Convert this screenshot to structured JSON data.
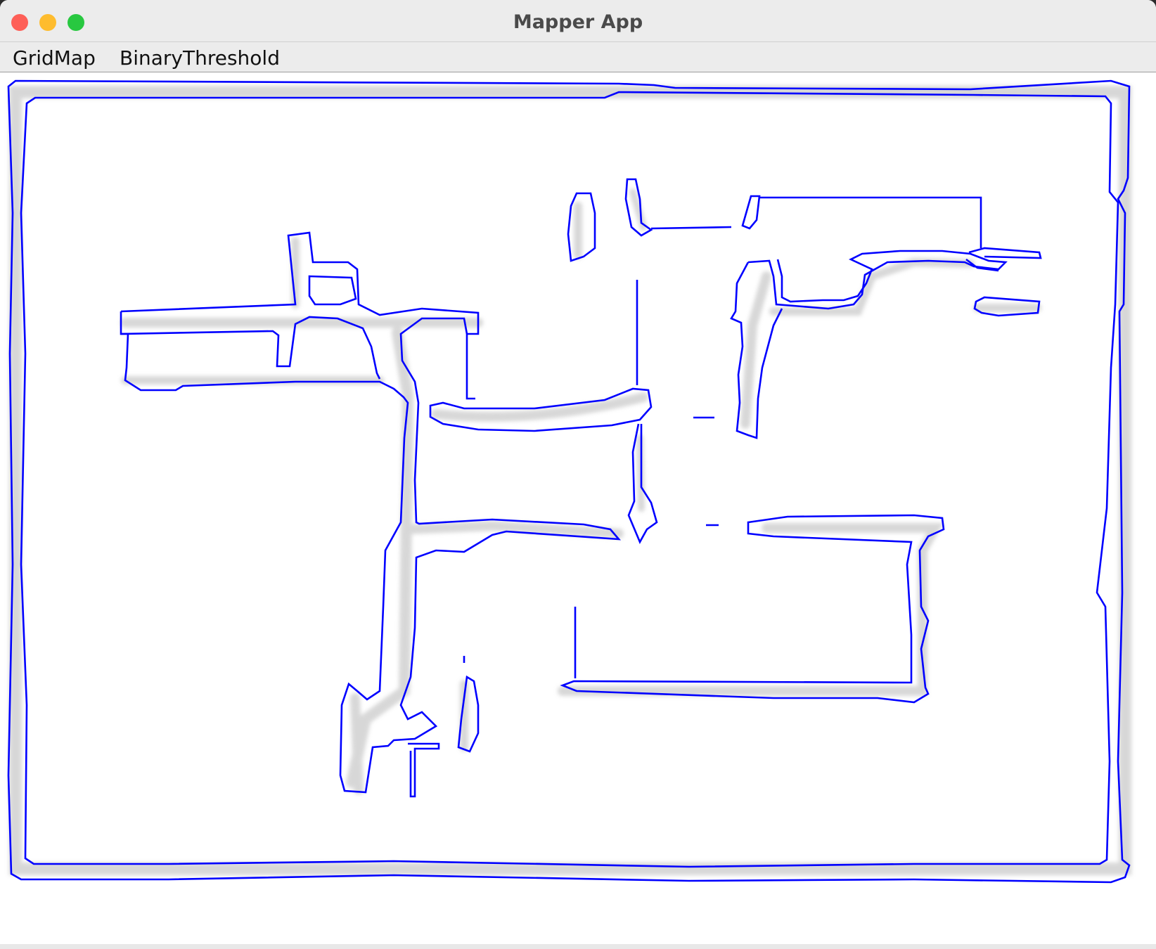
{
  "window": {
    "title": "Mapper App"
  },
  "window_controls": {
    "close_color": "#fe5f57",
    "minimize_color": "#febc2e",
    "maximize_color": "#28c840"
  },
  "menubar": {
    "items": [
      {
        "label": "GridMap"
      },
      {
        "label": "BinaryThreshold"
      }
    ]
  },
  "map": {
    "contour_color": "#0000ff",
    "occupancy_color": "#b8b8b8",
    "background_color": "#ffffff"
  }
}
